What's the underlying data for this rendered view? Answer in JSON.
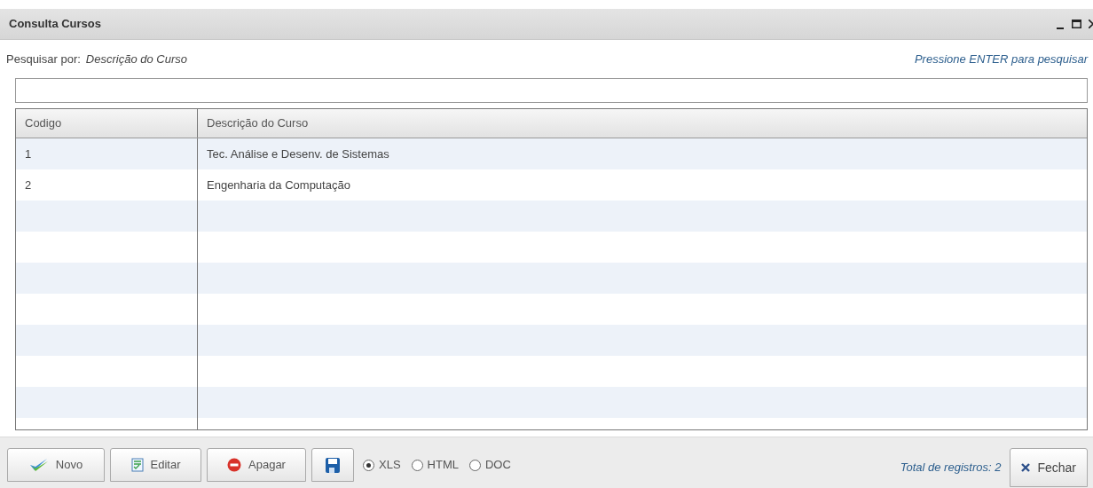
{
  "window": {
    "title": "Consulta Cursos"
  },
  "search": {
    "label": "Pesquisar por:",
    "field": "Descrição do Curso",
    "hint": "Pressione ENTER para pesquisar"
  },
  "table": {
    "columns": [
      "Codigo",
      "Descrição do Curso"
    ],
    "rows": [
      [
        "1",
        "Tec. Análise e Desenv. de Sistemas"
      ],
      [
        "2",
        "Engenharia da Computação"
      ]
    ]
  },
  "buttons": [
    {
      "kind": "new",
      "label": "Novo"
    },
    {
      "kind": "edit",
      "label": "Editar"
    },
    {
      "kind": "delete",
      "label": "Apagar"
    },
    {
      "kind": "save"
    }
  ],
  "formats": [
    {
      "label": "XLS",
      "selected": true
    },
    {
      "label": "HTML",
      "selected": false
    },
    {
      "label": "DOC",
      "selected": false
    }
  ],
  "total": "Total de registros: 2",
  "close_button": "Fechar"
}
